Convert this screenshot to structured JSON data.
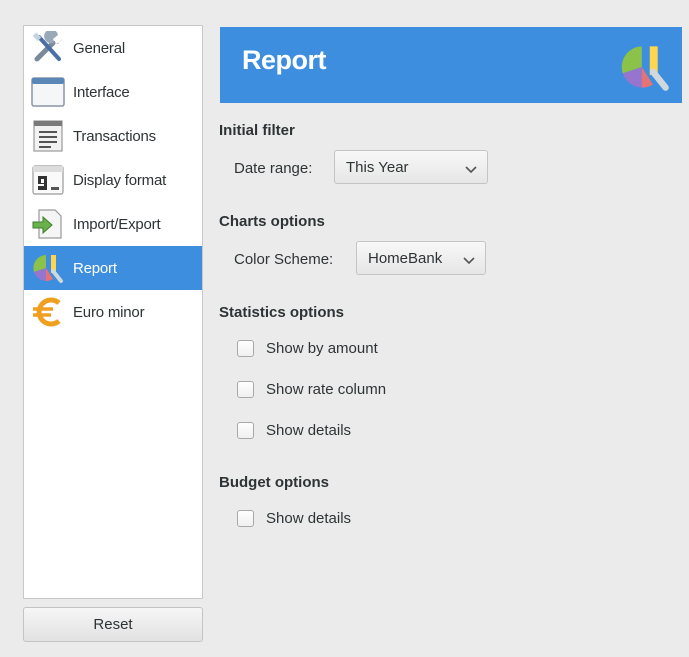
{
  "sidebar": {
    "items": [
      {
        "label": "General",
        "icon": "tools-icon"
      },
      {
        "label": "Interface",
        "icon": "window-icon"
      },
      {
        "label": "Transactions",
        "icon": "list-icon"
      },
      {
        "label": "Display format",
        "icon": "calendar-icon"
      },
      {
        "label": "Import/Export",
        "icon": "import-export-icon"
      },
      {
        "label": "Report",
        "icon": "report-icon",
        "active": true
      },
      {
        "label": "Euro minor",
        "icon": "euro-icon"
      }
    ],
    "reset_label": "Reset"
  },
  "banner": {
    "title": "Report",
    "icon": "report-icon"
  },
  "initial_filter": {
    "title": "Initial filter",
    "date_range_label": "Date range:",
    "date_range_value": "This Year"
  },
  "charts_options": {
    "title": "Charts options",
    "color_scheme_label": "Color Scheme:",
    "color_scheme_value": "HomeBank"
  },
  "statistics_options": {
    "title": "Statistics options",
    "show_by_amount": "Show by amount",
    "show_rate_column": "Show rate column",
    "show_details": "Show details"
  },
  "budget_options": {
    "title": "Budget options",
    "show_details": "Show details"
  },
  "colors": {
    "accent": "#3d8ede",
    "background": "#ebebeb"
  }
}
